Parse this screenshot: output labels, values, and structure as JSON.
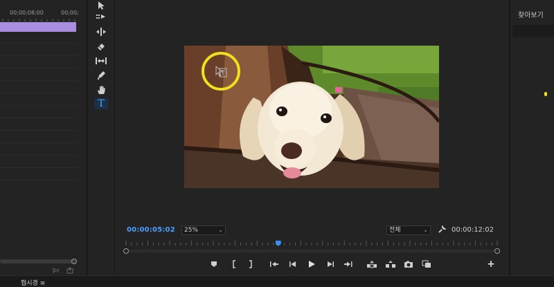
{
  "timeline": {
    "ruler_tc_1": "00;00;08;00",
    "ruler_tc_2": "00;00;"
  },
  "tools": {
    "items": [
      {
        "name": "selection-tool-icon"
      },
      {
        "name": "track-select-forward-icon"
      },
      {
        "name": "ripple-edit-icon"
      },
      {
        "name": "razor-icon"
      },
      {
        "name": "slip-icon"
      },
      {
        "name": "pen-icon"
      },
      {
        "name": "hand-icon"
      },
      {
        "name": "type-tool-icon",
        "active": true
      }
    ],
    "type_glyph": "T"
  },
  "monitor": {
    "current_timecode": "00:00:05:02",
    "zoom_label": "25%",
    "resolution_label": "전체",
    "duration_timecode": "00:00:12:02",
    "playhead_fraction": 0.41,
    "controls": [
      "add-marker-icon",
      "mark-in-icon",
      "mark-out-icon",
      "go-to-in-icon",
      "step-back-icon",
      "play-icon",
      "step-forward-icon",
      "go-to-out-icon",
      "lift-icon",
      "extract-icon",
      "export-frame-icon",
      "compare-view-icon"
    ],
    "add_button_glyph": "+"
  },
  "right_panel": {
    "search_label": "찾아보기"
  },
  "bottom": {
    "label": "협시경 ≡"
  },
  "colors": {
    "accent_blue": "#4aa0ff",
    "clip_purple": "#a98ee0",
    "highlight_yellow": "#f2e01c"
  }
}
